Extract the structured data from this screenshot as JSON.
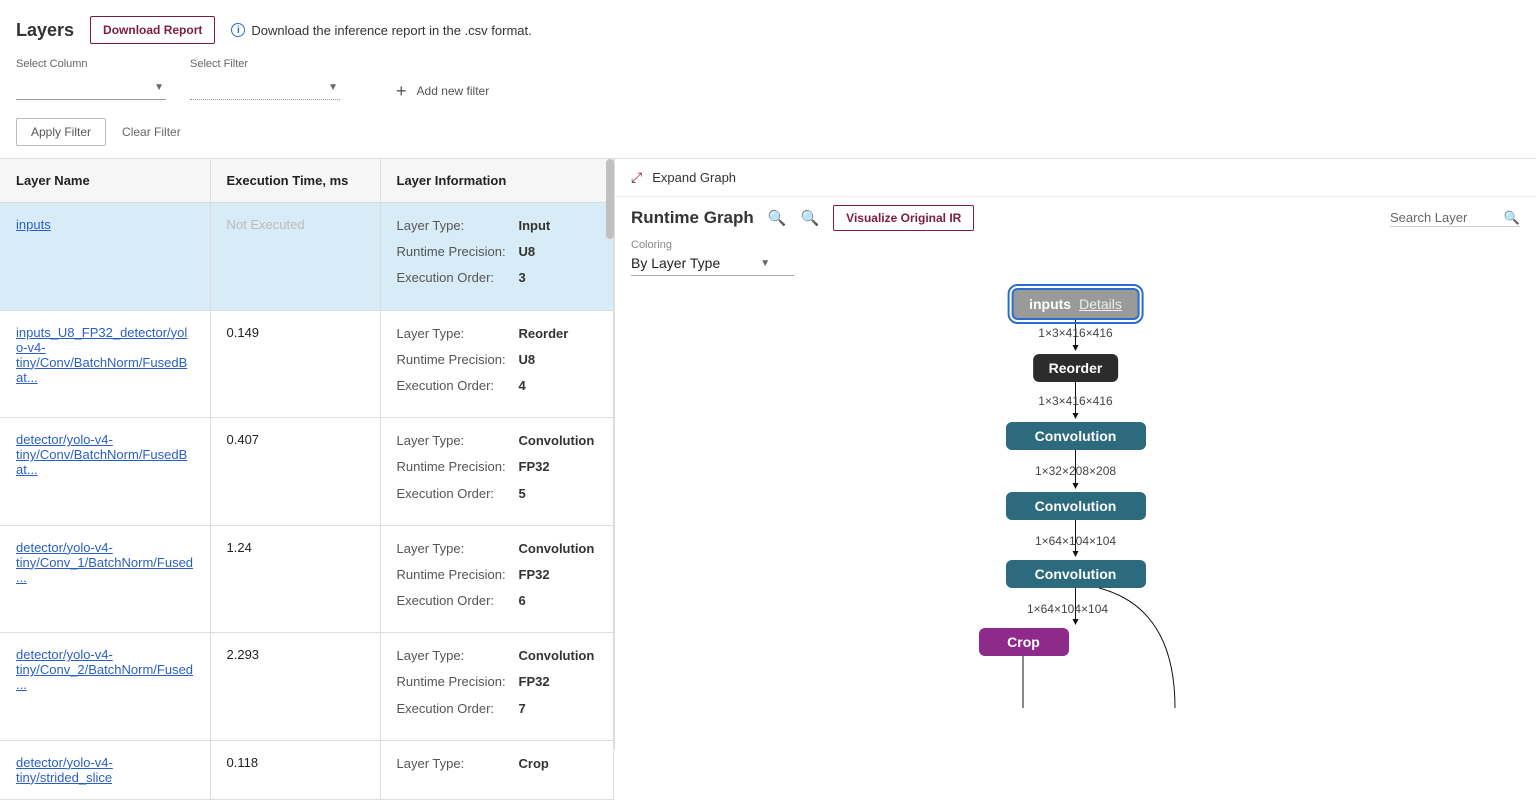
{
  "header": {
    "title": "Layers",
    "download_btn": "Download Report",
    "info_text": "Download the inference report in the .csv format."
  },
  "filters": {
    "select_column_label": "Select Column",
    "select_filter_label": "Select Filter",
    "add_new_filter": "Add new filter",
    "apply": "Apply Filter",
    "clear": "Clear Filter"
  },
  "table": {
    "cols": {
      "name": "Layer Name",
      "time": "Execution Time, ms",
      "info": "Layer Information"
    },
    "keys": {
      "type": "Layer Type:",
      "prec": "Runtime Precision:",
      "order": "Execution Order:"
    },
    "not_executed": "Not Executed",
    "rows": [
      {
        "name": "inputs",
        "time": "",
        "type": "Input",
        "prec": "U8",
        "order": "3"
      },
      {
        "name": "inputs_U8_FP32_detector/yolo-v4-tiny/Conv/BatchNorm/FusedBat...",
        "time": "0.149",
        "type": "Reorder",
        "prec": "U8",
        "order": "4"
      },
      {
        "name": "detector/yolo-v4-tiny/Conv/BatchNorm/FusedBat...",
        "time": "0.407",
        "type": "Convolution",
        "prec": "FP32",
        "order": "5"
      },
      {
        "name": "detector/yolo-v4-tiny/Conv_1/BatchNorm/Fused...",
        "time": "1.24",
        "type": "Convolution",
        "prec": "FP32",
        "order": "6"
      },
      {
        "name": "detector/yolo-v4-tiny/Conv_2/BatchNorm/Fused...",
        "time": "2.293",
        "type": "Convolution",
        "prec": "FP32",
        "order": "7"
      },
      {
        "name": "detector/yolo-v4-tiny/strided_slice",
        "time": "0.118",
        "type": "Crop",
        "prec": "",
        "order": ""
      }
    ]
  },
  "graph": {
    "expand": "Expand Graph",
    "title": "Runtime Graph",
    "visualize_btn": "Visualize Original IR",
    "search_placeholder": "Search Layer",
    "coloring_label": "Coloring",
    "coloring_value": "By Layer Type",
    "nodes": {
      "inputs": "inputs",
      "details": "Details",
      "reorder": "Reorder",
      "conv": "Convolution",
      "crop": "Crop"
    },
    "edges": {
      "e1": "1×3×416×416",
      "e2": "1×3×416×416",
      "e3": "1×32×208×208",
      "e4": "1×64×104×104",
      "e5": "1×64×104×104"
    }
  }
}
